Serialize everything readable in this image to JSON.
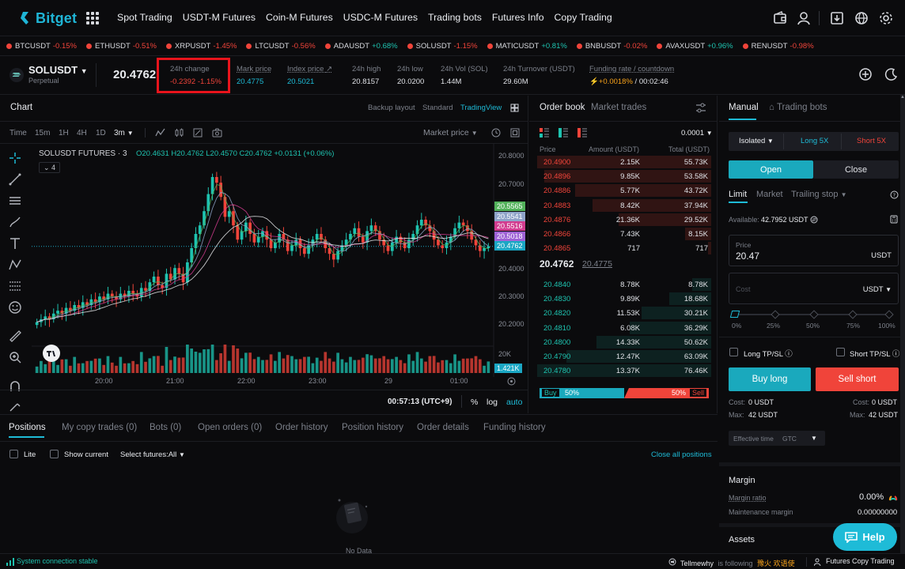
{
  "brand": {
    "name": "Bitget",
    "color": "#1fb5d6"
  },
  "nav": [
    "Spot Trading",
    "USDT-M Futures",
    "Coin-M Futures",
    "USDC-M Futures",
    "Trading bots",
    "Futures Info",
    "Copy Trading"
  ],
  "ticker": [
    {
      "sym": "BTCUSDT",
      "chg": "-0.15%",
      "dir": "down"
    },
    {
      "sym": "ETHUSDT",
      "chg": "-0.51%",
      "dir": "down"
    },
    {
      "sym": "XRPUSDT",
      "chg": "-1.45%",
      "dir": "down"
    },
    {
      "sym": "LTCUSDT",
      "chg": "-0.56%",
      "dir": "down"
    },
    {
      "sym": "ADAUSDT",
      "chg": "+0.68%",
      "dir": "up"
    },
    {
      "sym": "SOLUSDT",
      "chg": "-1.15%",
      "dir": "down"
    },
    {
      "sym": "MATICUSDT",
      "chg": "+0.81%",
      "dir": "up"
    },
    {
      "sym": "BNBUSDT",
      "chg": "-0.02%",
      "dir": "down"
    },
    {
      "sym": "AVAXUSDT",
      "chg": "+0.96%",
      "dir": "up"
    },
    {
      "sym": "RENUSDT",
      "chg": "-0.98%",
      "dir": "down"
    }
  ],
  "instrument": {
    "symbol": "SOLUSDT",
    "type": "Perpetual",
    "last": "20.4762",
    "change_label": "24h change",
    "change_value": "-0.2392 -1.15%",
    "mark_label": "Mark price",
    "mark_value": "20.4775",
    "index_label": "Index price",
    "index_value": "20.5021",
    "high_label": "24h high",
    "high_value": "20.8157",
    "low_label": "24h low",
    "low_value": "20.0200",
    "vol_label": "24h Vol (SOL)",
    "vol_value": "1.44M",
    "turnover_label": "24h Turnover (USDT)",
    "turnover_value": "29.60M",
    "funding_label": "Funding rate / countdown",
    "funding_rate": "+0.0018%",
    "funding_countdown": "/ 00:02:46"
  },
  "chart": {
    "title": "Chart",
    "layout_options": [
      "Backup layout",
      "Standard",
      "TradingView"
    ],
    "timeframes": [
      "Time",
      "15m",
      "1H",
      "4H",
      "1D",
      "3m"
    ],
    "price_source": "Market price",
    "legend_symbol": "SOLUSDT FUTURES · 3",
    "ohlc": {
      "o_label": "O",
      "o": "20.4631",
      "h_label": "H",
      "h": "20.4762",
      "l_label": "L",
      "l": "20.4570",
      "c_label": "C",
      "c": "20.4762",
      "chg": "+0.0131 (+0.06%)"
    },
    "indicator_count": "4",
    "price_ticks": [
      "20.8000",
      "20.7000",
      "20.4000",
      "20.3000",
      "20.2000"
    ],
    "ma_labels": [
      {
        "v": "20.5565",
        "color": "#53b25b"
      },
      {
        "v": "20.5541",
        "color": "#8fa4c9"
      },
      {
        "v": "20.5516",
        "color": "#d23c8f"
      },
      {
        "v": "20.5018",
        "color": "#9e63d6"
      },
      {
        "v": "20.4762",
        "color": "#1ba7c4"
      }
    ],
    "vol_tick": "20K",
    "vol_last": "1.421K",
    "time_ticks": [
      "20:00",
      "21:00",
      "22:00",
      "23:00",
      "29",
      "01:00"
    ],
    "clock": "00:57:13 (UTC+9)",
    "scale_opts": [
      "%",
      "log",
      "auto"
    ]
  },
  "orderbook": {
    "tabs": [
      "Order book",
      "Market trades"
    ],
    "precision": "0.0001",
    "headers": [
      "Price",
      "Amount (USDT)",
      "Total (USDT)"
    ],
    "asks": [
      {
        "p": "20.4900",
        "a": "2.15K",
        "t": "55.73K",
        "depth": 1.0
      },
      {
        "p": "20.4896",
        "a": "9.85K",
        "t": "53.58K",
        "depth": 0.96
      },
      {
        "p": "20.4886",
        "a": "5.77K",
        "t": "43.72K",
        "depth": 0.78
      },
      {
        "p": "20.4883",
        "a": "8.42K",
        "t": "37.94K",
        "depth": 0.68
      },
      {
        "p": "20.4876",
        "a": "21.36K",
        "t": "29.52K",
        "depth": 0.53
      },
      {
        "p": "20.4866",
        "a": "7.43K",
        "t": "8.15K",
        "depth": 0.15
      },
      {
        "p": "20.4865",
        "a": "717",
        "t": "717",
        "depth": 0.02
      }
    ],
    "last": "20.4762",
    "mark": "20.4775",
    "bids": [
      {
        "p": "20.4840",
        "a": "8.78K",
        "t": "8.78K",
        "depth": 0.11
      },
      {
        "p": "20.4830",
        "a": "9.89K",
        "t": "18.68K",
        "depth": 0.24
      },
      {
        "p": "20.4820",
        "a": "11.53K",
        "t": "30.21K",
        "depth": 0.4
      },
      {
        "p": "20.4810",
        "a": "6.08K",
        "t": "36.29K",
        "depth": 0.47
      },
      {
        "p": "20.4800",
        "a": "14.33K",
        "t": "50.62K",
        "depth": 0.66
      },
      {
        "p": "20.4790",
        "a": "12.47K",
        "t": "63.09K",
        "depth": 0.83
      },
      {
        "p": "20.4780",
        "a": "13.37K",
        "t": "76.46K",
        "depth": 1.0
      }
    ],
    "buy_label": "Buy",
    "buy_pct": "50%",
    "sell_pct": "50%",
    "sell_label": "Sell"
  },
  "trade": {
    "tabs": [
      "Manual",
      "Trading bots"
    ],
    "margin_mode": "Isolated",
    "long_lev": "Long 5X",
    "short_lev": "Short 5X",
    "open": "Open",
    "close": "Close",
    "order_types": [
      "Limit",
      "Market",
      "Trailing stop"
    ],
    "available_label": "Available:",
    "available": "42.7952 USDT",
    "price_label": "Price",
    "price_value": "20.47",
    "price_unit": "USDT",
    "cost_placeholder": "Cost",
    "cost_unit": "USDT",
    "slider_marks": [
      "0%",
      "25%",
      "50%",
      "75%",
      "100%"
    ],
    "long_tpsl": "Long TP/SL",
    "short_tpsl": "Short TP/SL",
    "buy_long": "Buy long",
    "sell_short": "Sell short",
    "cost_l_label": "Cost:",
    "cost_l": "0 USDT",
    "max_l_label": "Max:",
    "max_l": "42 USDT",
    "cost_r_label": "Cost:",
    "cost_r": "0 USDT",
    "max_r_label": "Max:",
    "max_r": "42 USDT",
    "effective_label": "Effective time",
    "effective_value": "GTC",
    "margin_title": "Margin",
    "margin_ratio_label": "Margin ratio",
    "margin_ratio": "0.00%",
    "maint_label": "Maintenance margin",
    "maint_value": "0.00000000",
    "assets_title": "Assets",
    "help": "Help"
  },
  "positions": {
    "tabs": [
      "Positions",
      "My copy trades (0)",
      "Bots (0)",
      "Open orders (0)",
      "Order history",
      "Position history",
      "Order details",
      "Funding history"
    ],
    "lite": "Lite",
    "show_current": "Show current",
    "select_futures": "Select futures:All",
    "close_all": "Close all positions",
    "no_data": "No Data"
  },
  "status": {
    "connection": "System connection stable",
    "follower": "Tellmewhy",
    "is_following": "is following",
    "leader": "豫火 欢语使",
    "copy_trading": "Futures Copy Trading"
  },
  "colors": {
    "up": "#1ec3b0",
    "down": "#f0443a",
    "accent": "#1ebbd7",
    "buy": "#1aa9bd",
    "sell": "#f0443a"
  },
  "chart_data": {
    "type": "candlestick",
    "x_ticks": [
      "20:00",
      "21:00",
      "22:00",
      "23:00",
      "29",
      "01:00"
    ],
    "y_ticks": [
      20.8,
      20.7,
      20.4,
      20.3,
      20.2
    ],
    "ylim": [
      20.17,
      20.82
    ],
    "ohlc_last": {
      "open": 20.4631,
      "high": 20.4762,
      "low": 20.457,
      "close": 20.4762
    },
    "close_series": [
      20.21,
      20.22,
      20.23,
      20.22,
      20.24,
      20.25,
      20.24,
      20.26,
      20.25,
      20.27,
      20.26,
      20.28,
      20.27,
      20.29,
      20.28,
      20.3,
      20.29,
      20.31,
      20.3,
      20.29,
      20.31,
      20.3,
      20.32,
      20.31,
      20.3,
      20.33,
      20.32,
      20.35,
      20.37,
      20.34,
      20.33,
      20.38,
      20.36,
      20.4,
      20.38,
      20.35,
      20.42,
      20.47,
      20.52,
      20.55,
      20.6,
      20.66,
      20.72,
      20.7,
      20.65,
      20.58,
      20.6,
      20.55,
      20.5,
      20.53,
      20.56,
      20.52,
      20.49,
      20.51,
      20.53,
      20.5,
      20.47,
      20.49,
      20.52,
      20.5,
      20.46,
      20.48,
      20.5,
      20.47,
      20.45,
      20.48,
      20.5,
      20.52,
      20.5,
      20.47,
      20.45,
      20.43,
      20.46,
      20.48,
      20.5,
      20.52,
      20.54,
      20.51,
      20.49,
      20.53,
      20.55,
      20.53,
      20.5,
      20.48,
      20.46,
      20.49,
      20.51,
      20.49,
      20.47,
      20.5,
      20.52,
      20.55,
      20.57,
      20.55,
      20.53,
      20.5,
      20.48,
      20.47,
      20.49,
      20.51,
      20.54,
      20.56,
      20.55,
      20.53,
      20.5,
      20.48,
      20.46,
      20.47,
      20.4762
    ],
    "ma_last": [
      20.5565,
      20.5541,
      20.5516,
      20.5018,
      20.4762
    ]
  }
}
